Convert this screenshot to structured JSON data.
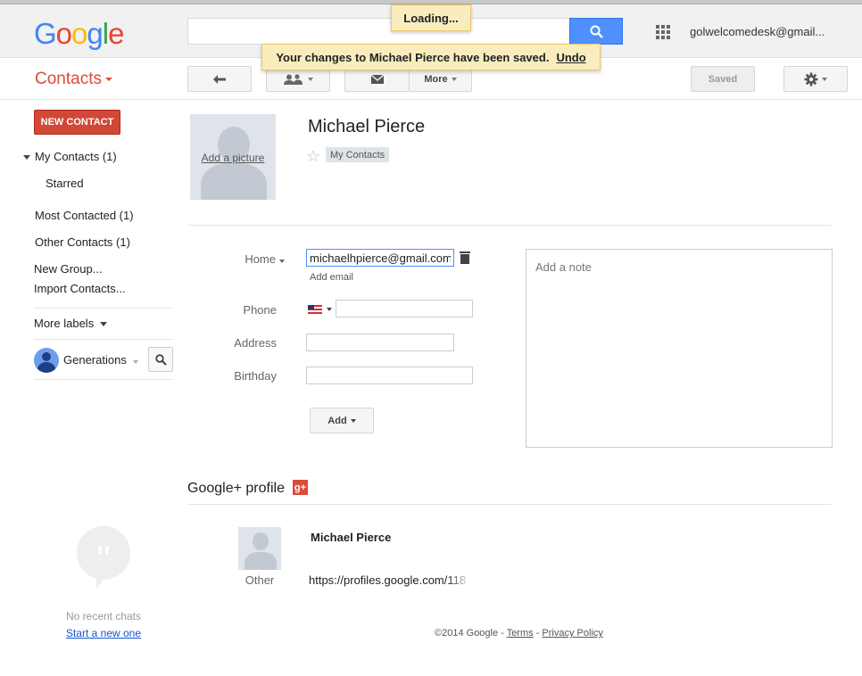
{
  "header": {
    "logo": "Google",
    "search_value": "",
    "account": "golwelcomedesk@gmail...",
    "loading": "Loading...",
    "toast_message": "Your changes to Michael Pierce have been saved.",
    "toast_undo": "Undo"
  },
  "toolbar": {
    "app_title": "Contacts",
    "more_label": "More",
    "saved_label": "Saved"
  },
  "sidebar": {
    "new_contact": "NEW CONTACT",
    "my_contacts": "My Contacts (1)",
    "starred": "Starred",
    "most_contacted": "Most Contacted (1)",
    "other_contacts": "Other Contacts (1)",
    "new_group": "New Group...",
    "import_contacts": "Import Contacts...",
    "more_labels": "More labels",
    "hangouts_user": "Generations",
    "no_recent_chats": "No recent chats",
    "start_new": "Start a new one"
  },
  "contact": {
    "add_picture": "Add a picture",
    "name": "Michael Pierce",
    "group_chip": "My Contacts",
    "email_label": "Home",
    "email_value": "michaelhpierce@gmail.com",
    "add_email": "Add email",
    "phone_label": "Phone",
    "phone_value": "",
    "address_label": "Address",
    "address_value": "",
    "birthday_label": "Birthday",
    "birthday_value": "",
    "note_placeholder": "Add a note",
    "add_button": "Add"
  },
  "gplus": {
    "title": "Google+ profile",
    "badge": "g+",
    "name": "Michael Pierce",
    "other_label": "Other",
    "url": "https://profiles.google.com/118"
  },
  "footer": {
    "copyright": "©2014 Google - ",
    "terms": "Terms",
    "sep": " - ",
    "privacy": "Privacy Policy"
  },
  "colors": {
    "google_blue": "#4285f4",
    "google_red": "#dd4b39",
    "accent_blue": "#4d90fe",
    "toast_bg": "#f9edbe"
  }
}
